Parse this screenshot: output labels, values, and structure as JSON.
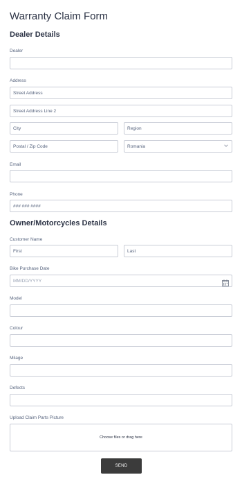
{
  "form": {
    "title": "Warranty Claim Form",
    "dealer_section": "Dealer Details",
    "owner_section": "Owner/Motorcycles Details",
    "send_label": "SEND"
  },
  "dealer": {
    "label": "Dealer",
    "value": ""
  },
  "address": {
    "label": "Address",
    "street_placeholder": "Street Address",
    "street2_placeholder": "Street Address Line 2",
    "city_placeholder": "City",
    "region_placeholder": "Region",
    "postal_placeholder": "Postal / Zip Code",
    "country_selected": "Romania"
  },
  "email": {
    "label": "Email",
    "value": ""
  },
  "phone": {
    "label": "Phone",
    "placeholder": "### ### ####"
  },
  "customer": {
    "label": "Customer Name",
    "first_placeholder": "First",
    "last_placeholder": "Last"
  },
  "purchase_date": {
    "label": "Bike Purchase Date",
    "placeholder": "MM/DD/YYYY"
  },
  "model": {
    "label": "Model",
    "value": ""
  },
  "colour": {
    "label": "Colour",
    "value": ""
  },
  "milage": {
    "label": "Milage",
    "value": ""
  },
  "defects": {
    "label": "Defects",
    "value": ""
  },
  "upload": {
    "label": "Upload Claim Parts Picture",
    "prompt": "Choose files or drag here"
  },
  "icons": {
    "dropdown": "chevron-down-icon",
    "calendar": "calendar-icon"
  }
}
